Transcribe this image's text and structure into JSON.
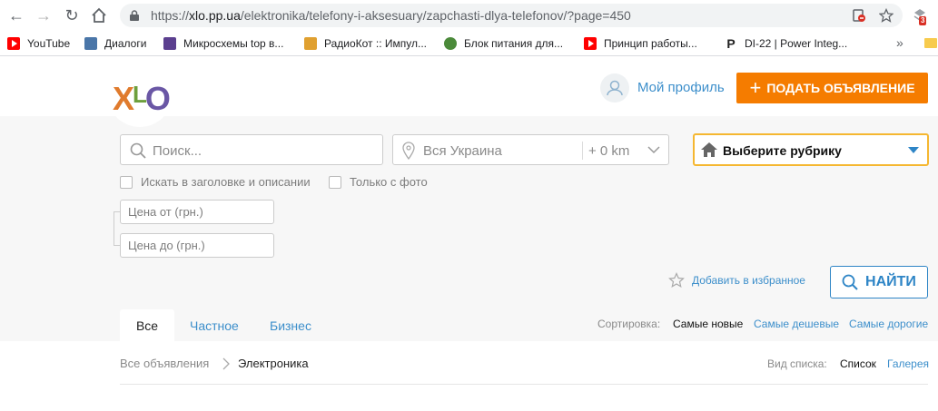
{
  "browser": {
    "url": {
      "scheme": "https://",
      "host": "xlo.pp.ua",
      "path": "/elektronika/telefony-i-aksesuary/zapchasti-dlya-telefonov/?page=450"
    },
    "extension_badge": "3",
    "bookmarks": [
      {
        "label": "YouTube",
        "icon": "youtube-icon",
        "color": "#ff0000"
      },
      {
        "label": "Диалоги",
        "icon": "chat-icon",
        "color": "#4a76a8"
      },
      {
        "label": "Микросхемы top в...",
        "icon": "chip-icon",
        "color": "#5b3f8f"
      },
      {
        "label": "РадиоКот :: Импул...",
        "icon": "cat-icon",
        "color": "#e0a030"
      },
      {
        "label": "Блок питания для...",
        "icon": "globe-icon",
        "color": "#4b8a3a"
      },
      {
        "label": "Принцип работы...",
        "icon": "youtube-icon",
        "color": "#ff0000"
      },
      {
        "label": "DI-22 | Power Integ...",
        "icon": "p-logo-icon",
        "color": "#222222"
      }
    ],
    "bookmarks_more": "»"
  },
  "site": {
    "logo": {
      "x": "X",
      "l": "L",
      "o": "O"
    },
    "profile_label": "Мой профиль",
    "post_ad_label": "ПОДАТЬ ОБЪЯВЛЕНИЕ",
    "accent_color": "#f57c00",
    "link_color": "#3d8fcb"
  },
  "search": {
    "query_placeholder": "Поиск...",
    "location_placeholder": "Вся Украина",
    "radius": "+ 0 km",
    "category_label": "Выберите рубрику",
    "checkbox_title_desc": "Искать в заголовке и описании",
    "checkbox_photo": "Только с фото",
    "price_from_placeholder": "Цена от (грн.)",
    "price_to_placeholder": "Цена до (грн.)",
    "favorite_label": "Добавить в избранное",
    "find_label": "НАЙТИ"
  },
  "tabs": [
    "Все",
    "Частное",
    "Бизнес"
  ],
  "sorting": {
    "label": "Сортировка:",
    "current": "Самые новые",
    "options": [
      "Самые дешевые",
      "Самые дорогие"
    ]
  },
  "breadcrumb": [
    "Все объявления",
    "Электроника"
  ],
  "view": {
    "label": "Вид списка:",
    "current": "Список",
    "option": "Галерея"
  }
}
